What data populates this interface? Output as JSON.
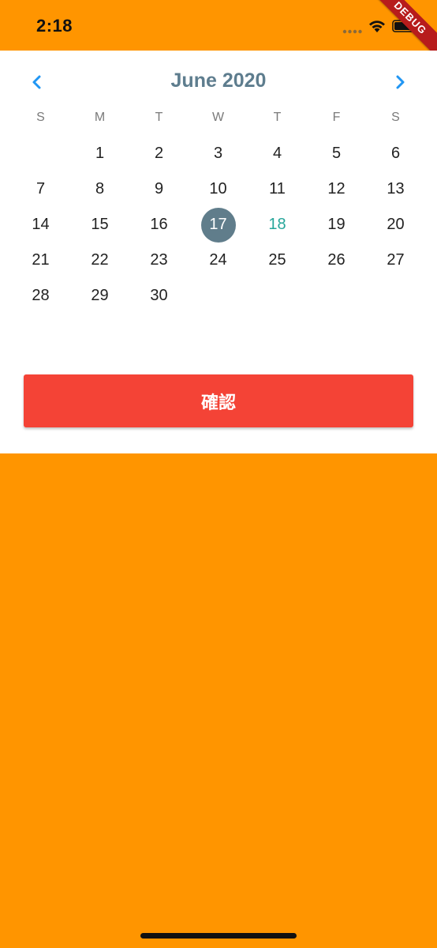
{
  "status_bar": {
    "time": "2:18",
    "debug_label": "DEBUG"
  },
  "calendar": {
    "month_title": "June 2020",
    "weekdays": [
      "S",
      "M",
      "T",
      "W",
      "T",
      "F",
      "S"
    ],
    "weeks": [
      [
        "",
        "1",
        "2",
        "3",
        "4",
        "5",
        "6"
      ],
      [
        "7",
        "8",
        "9",
        "10",
        "11",
        "12",
        "13"
      ],
      [
        "14",
        "15",
        "16",
        "17",
        "18",
        "19",
        "20"
      ],
      [
        "21",
        "22",
        "23",
        "24",
        "25",
        "26",
        "27"
      ],
      [
        "28",
        "29",
        "30",
        "",
        "",
        "",
        ""
      ]
    ],
    "selected_day": "17",
    "today": "18"
  },
  "confirm_button": {
    "label": "確認"
  },
  "colors": {
    "background": "#FF9500",
    "month_title": "#5E7D8E",
    "selected_circle": "#607D8B",
    "today_text": "#26A69A",
    "nav_arrows": "#2196F3",
    "confirm_button": "#F44336",
    "debug_banner": "#B71C1C"
  },
  "icons": {
    "prev": "chevron-left-icon",
    "next": "chevron-right-icon",
    "signal": "signal-icon",
    "wifi": "wifi-icon",
    "battery": "battery-icon"
  }
}
